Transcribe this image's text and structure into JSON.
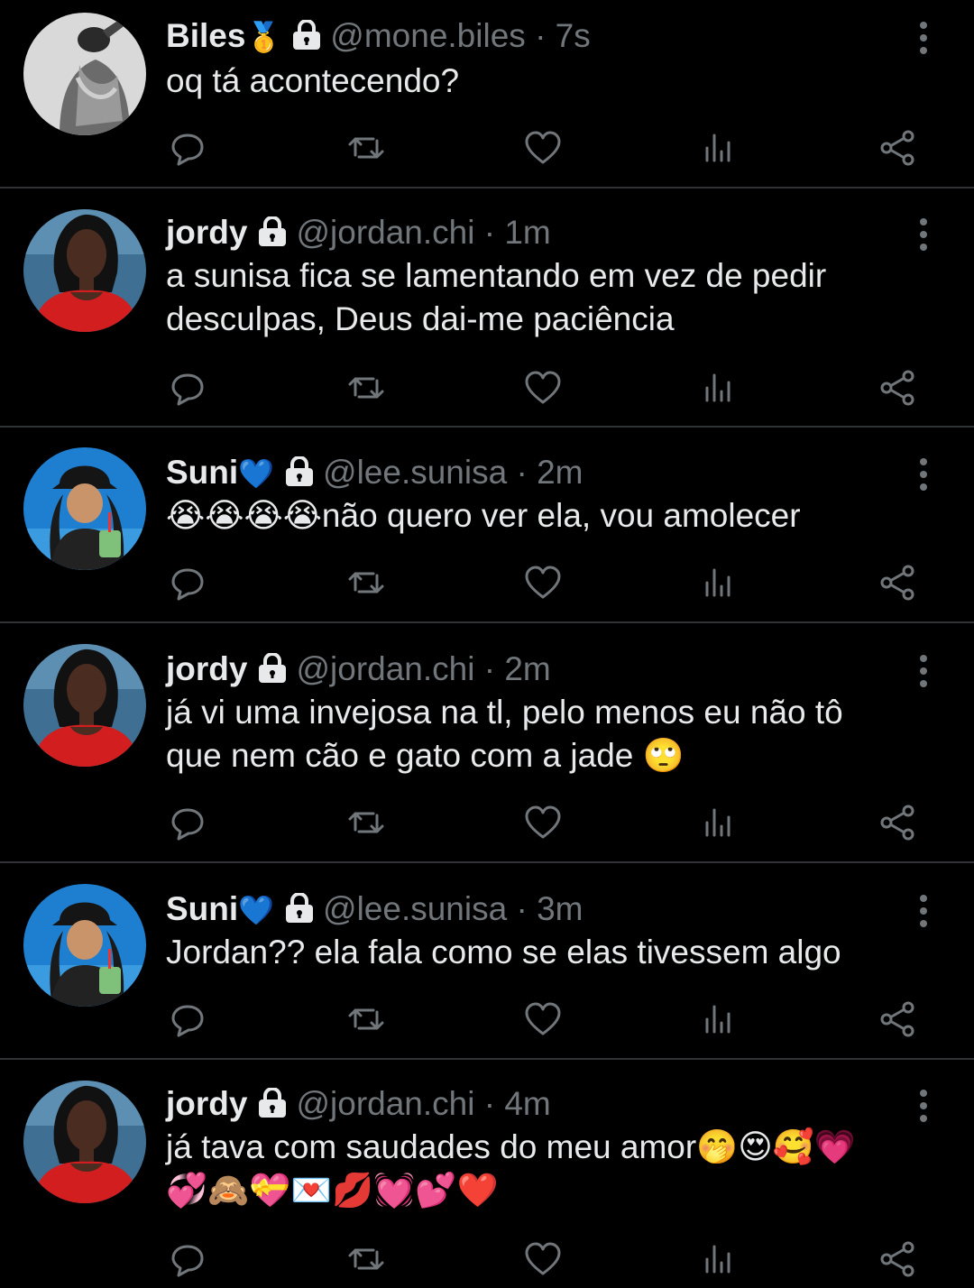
{
  "colors": {
    "background": "#000000",
    "text": "#e7e9ea",
    "muted": "#71767b",
    "divider": "#2f3336"
  },
  "tweets": [
    {
      "name": "Biles",
      "badge": "🥇",
      "handle": "@mone.biles",
      "dot": "·",
      "time": "7s",
      "text": "oq tá acontecendo?",
      "avatar": "bw-portrait"
    },
    {
      "name": "jordy",
      "badge": "",
      "handle": "@jordan.chi",
      "dot": "·",
      "time": "1m",
      "text": "a sunisa fica se lamentando em vez de pedir\ndesculpas, Deus dai-me paciência",
      "avatar": "red-top-portrait"
    },
    {
      "name": "Suni",
      "badge": "💙",
      "handle": "@lee.sunisa",
      "dot": "·",
      "time": "2m",
      "text": "😭😭😭😭não quero ver ela, vou amolecer",
      "avatar": "bucket-hat-portrait"
    },
    {
      "name": "jordy",
      "badge": "",
      "handle": "@jordan.chi",
      "dot": "·",
      "time": "2m",
      "text": "já vi uma invejosa na tl, pelo menos eu não tô\nque nem cão e gato com a jade 🙄",
      "avatar": "red-top-portrait"
    },
    {
      "name": "Suni",
      "badge": "💙",
      "handle": "@lee.sunisa",
      "dot": "·",
      "time": "3m",
      "text": "Jordan?? ela fala como se elas tivessem algo",
      "avatar": "bucket-hat-portrait"
    },
    {
      "name": "jordy",
      "badge": "",
      "handle": "@jordan.chi",
      "dot": "·",
      "time": "4m",
      "text": "já tava com saudades do meu amor🤭😍🥰💗\n💞🙈💝💌💋💓💕❤️",
      "avatar": "red-top-portrait"
    }
  ],
  "actions": [
    "reply-icon",
    "retweet-icon",
    "like-icon",
    "views-icon",
    "share-icon"
  ]
}
